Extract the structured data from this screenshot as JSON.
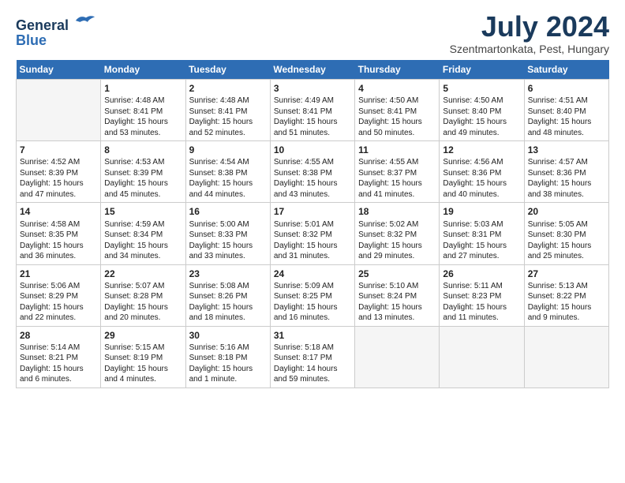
{
  "header": {
    "logo_line1": "General",
    "logo_line2": "Blue",
    "month": "July 2024",
    "location": "Szentmartonkata, Pest, Hungary"
  },
  "days_of_week": [
    "Sunday",
    "Monday",
    "Tuesday",
    "Wednesday",
    "Thursday",
    "Friday",
    "Saturday"
  ],
  "weeks": [
    [
      {
        "day": "",
        "sunrise": "",
        "sunset": "",
        "daylight": ""
      },
      {
        "day": "1",
        "sunrise": "Sunrise: 4:48 AM",
        "sunset": "Sunset: 8:41 PM",
        "daylight": "Daylight: 15 hours and 53 minutes."
      },
      {
        "day": "2",
        "sunrise": "Sunrise: 4:48 AM",
        "sunset": "Sunset: 8:41 PM",
        "daylight": "Daylight: 15 hours and 52 minutes."
      },
      {
        "day": "3",
        "sunrise": "Sunrise: 4:49 AM",
        "sunset": "Sunset: 8:41 PM",
        "daylight": "Daylight: 15 hours and 51 minutes."
      },
      {
        "day": "4",
        "sunrise": "Sunrise: 4:50 AM",
        "sunset": "Sunset: 8:41 PM",
        "daylight": "Daylight: 15 hours and 50 minutes."
      },
      {
        "day": "5",
        "sunrise": "Sunrise: 4:50 AM",
        "sunset": "Sunset: 8:40 PM",
        "daylight": "Daylight: 15 hours and 49 minutes."
      },
      {
        "day": "6",
        "sunrise": "Sunrise: 4:51 AM",
        "sunset": "Sunset: 8:40 PM",
        "daylight": "Daylight: 15 hours and 48 minutes."
      }
    ],
    [
      {
        "day": "7",
        "sunrise": "Sunrise: 4:52 AM",
        "sunset": "Sunset: 8:39 PM",
        "daylight": "Daylight: 15 hours and 47 minutes."
      },
      {
        "day": "8",
        "sunrise": "Sunrise: 4:53 AM",
        "sunset": "Sunset: 8:39 PM",
        "daylight": "Daylight: 15 hours and 45 minutes."
      },
      {
        "day": "9",
        "sunrise": "Sunrise: 4:54 AM",
        "sunset": "Sunset: 8:38 PM",
        "daylight": "Daylight: 15 hours and 44 minutes."
      },
      {
        "day": "10",
        "sunrise": "Sunrise: 4:55 AM",
        "sunset": "Sunset: 8:38 PM",
        "daylight": "Daylight: 15 hours and 43 minutes."
      },
      {
        "day": "11",
        "sunrise": "Sunrise: 4:55 AM",
        "sunset": "Sunset: 8:37 PM",
        "daylight": "Daylight: 15 hours and 41 minutes."
      },
      {
        "day": "12",
        "sunrise": "Sunrise: 4:56 AM",
        "sunset": "Sunset: 8:36 PM",
        "daylight": "Daylight: 15 hours and 40 minutes."
      },
      {
        "day": "13",
        "sunrise": "Sunrise: 4:57 AM",
        "sunset": "Sunset: 8:36 PM",
        "daylight": "Daylight: 15 hours and 38 minutes."
      }
    ],
    [
      {
        "day": "14",
        "sunrise": "Sunrise: 4:58 AM",
        "sunset": "Sunset: 8:35 PM",
        "daylight": "Daylight: 15 hours and 36 minutes."
      },
      {
        "day": "15",
        "sunrise": "Sunrise: 4:59 AM",
        "sunset": "Sunset: 8:34 PM",
        "daylight": "Daylight: 15 hours and 34 minutes."
      },
      {
        "day": "16",
        "sunrise": "Sunrise: 5:00 AM",
        "sunset": "Sunset: 8:33 PM",
        "daylight": "Daylight: 15 hours and 33 minutes."
      },
      {
        "day": "17",
        "sunrise": "Sunrise: 5:01 AM",
        "sunset": "Sunset: 8:32 PM",
        "daylight": "Daylight: 15 hours and 31 minutes."
      },
      {
        "day": "18",
        "sunrise": "Sunrise: 5:02 AM",
        "sunset": "Sunset: 8:32 PM",
        "daylight": "Daylight: 15 hours and 29 minutes."
      },
      {
        "day": "19",
        "sunrise": "Sunrise: 5:03 AM",
        "sunset": "Sunset: 8:31 PM",
        "daylight": "Daylight: 15 hours and 27 minutes."
      },
      {
        "day": "20",
        "sunrise": "Sunrise: 5:05 AM",
        "sunset": "Sunset: 8:30 PM",
        "daylight": "Daylight: 15 hours and 25 minutes."
      }
    ],
    [
      {
        "day": "21",
        "sunrise": "Sunrise: 5:06 AM",
        "sunset": "Sunset: 8:29 PM",
        "daylight": "Daylight: 15 hours and 22 minutes."
      },
      {
        "day": "22",
        "sunrise": "Sunrise: 5:07 AM",
        "sunset": "Sunset: 8:28 PM",
        "daylight": "Daylight: 15 hours and 20 minutes."
      },
      {
        "day": "23",
        "sunrise": "Sunrise: 5:08 AM",
        "sunset": "Sunset: 8:26 PM",
        "daylight": "Daylight: 15 hours and 18 minutes."
      },
      {
        "day": "24",
        "sunrise": "Sunrise: 5:09 AM",
        "sunset": "Sunset: 8:25 PM",
        "daylight": "Daylight: 15 hours and 16 minutes."
      },
      {
        "day": "25",
        "sunrise": "Sunrise: 5:10 AM",
        "sunset": "Sunset: 8:24 PM",
        "daylight": "Daylight: 15 hours and 13 minutes."
      },
      {
        "day": "26",
        "sunrise": "Sunrise: 5:11 AM",
        "sunset": "Sunset: 8:23 PM",
        "daylight": "Daylight: 15 hours and 11 minutes."
      },
      {
        "day": "27",
        "sunrise": "Sunrise: 5:13 AM",
        "sunset": "Sunset: 8:22 PM",
        "daylight": "Daylight: 15 hours and 9 minutes."
      }
    ],
    [
      {
        "day": "28",
        "sunrise": "Sunrise: 5:14 AM",
        "sunset": "Sunset: 8:21 PM",
        "daylight": "Daylight: 15 hours and 6 minutes."
      },
      {
        "day": "29",
        "sunrise": "Sunrise: 5:15 AM",
        "sunset": "Sunset: 8:19 PM",
        "daylight": "Daylight: 15 hours and 4 minutes."
      },
      {
        "day": "30",
        "sunrise": "Sunrise: 5:16 AM",
        "sunset": "Sunset: 8:18 PM",
        "daylight": "Daylight: 15 hours and 1 minute."
      },
      {
        "day": "31",
        "sunrise": "Sunrise: 5:18 AM",
        "sunset": "Sunset: 8:17 PM",
        "daylight": "Daylight: 14 hours and 59 minutes."
      },
      {
        "day": "",
        "sunrise": "",
        "sunset": "",
        "daylight": ""
      },
      {
        "day": "",
        "sunrise": "",
        "sunset": "",
        "daylight": ""
      },
      {
        "day": "",
        "sunrise": "",
        "sunset": "",
        "daylight": ""
      }
    ]
  ]
}
